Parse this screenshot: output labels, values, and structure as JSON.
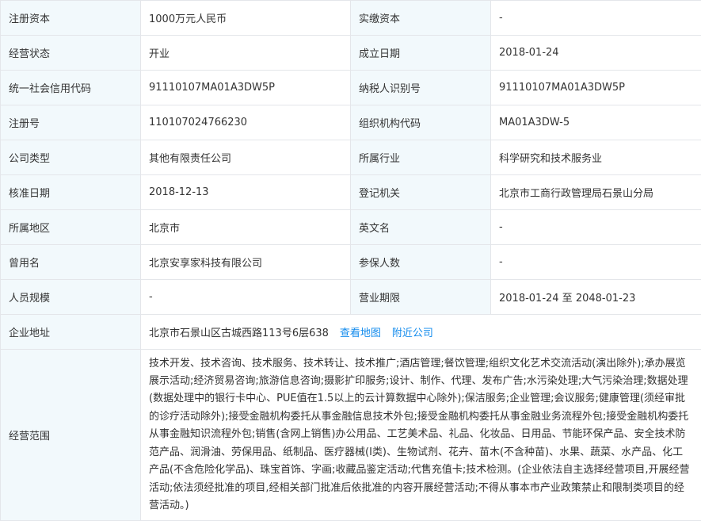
{
  "rows": [
    {
      "l1": "注册资本",
      "v1": "1000万元人民币",
      "l2": "实缴资本",
      "v2": "-"
    },
    {
      "l1": "经营状态",
      "v1": "开业",
      "l2": "成立日期",
      "v2": "2018-01-24"
    },
    {
      "l1": "统一社会信用代码",
      "v1": "91110107MA01A3DW5P",
      "l2": "纳税人识别号",
      "v2": "91110107MA01A3DW5P"
    },
    {
      "l1": "注册号",
      "v1": "110107024766230",
      "l2": "组织机构代码",
      "v2": "MA01A3DW-5"
    },
    {
      "l1": "公司类型",
      "v1": "其他有限责任公司",
      "l2": "所属行业",
      "v2": "科学研究和技术服务业"
    },
    {
      "l1": "核准日期",
      "v1": "2018-12-13",
      "l2": "登记机关",
      "v2": "北京市工商行政管理局石景山分局"
    },
    {
      "l1": "所属地区",
      "v1": "北京市",
      "l2": "英文名",
      "v2": "-"
    },
    {
      "l1": "曾用名",
      "v1": "北京安享家科技有限公司",
      "l2": "参保人数",
      "v2": "-"
    },
    {
      "l1": "人员规模",
      "v1": "-",
      "l2": "营业期限",
      "v2": "2018-01-24 至 2048-01-23"
    }
  ],
  "address": {
    "label": "企业地址",
    "value": "北京市石景山区古城西路113号6层638",
    "map_link": "查看地图",
    "nearby_link": "附近公司"
  },
  "scope": {
    "label": "经营范围",
    "text": "技术开发、技术咨询、技术服务、技术转让、技术推广;酒店管理;餐饮管理;组织文化艺术交流活动(演出除外);承办展览展示活动;经济贸易咨询;旅游信息咨询;摄影扩印服务;设计、制作、代理、发布广告;水污染处理;大气污染治理;数据处理(数据处理中的银行卡中心、PUE值在1.5以上的云计算数据中心除外);保洁服务;企业管理;会议服务;健康管理(须经审批的诊疗活动除外);接受金融机构委托从事金融信息技术外包;接受金融机构委托从事金融业务流程外包;接受金融机构委托从事金融知识流程外包;销售(含网上销售)办公用品、工艺美术品、礼品、化妆品、日用品、节能环保产品、安全技术防范产品、润滑油、劳保用品、纸制品、医疗器械(I类)、生物试剂、花卉、苗木(不含种苗)、水果、蔬菜、水产品、化工产品(不含危险化学品)、珠宝首饰、字画;收藏品鉴定活动;代售充值卡;技术检测。(企业依法自主选择经营项目,开展经营活动;依法须经批准的项目,经相关部门批准后依批准的内容开展经营活动;不得从事本市产业政策禁止和限制类项目的经营活动。)"
  },
  "colors": {
    "label_bg": "#f2f9fc",
    "border": "#e4e6ea",
    "link": "#128bed",
    "text": "#333333"
  }
}
